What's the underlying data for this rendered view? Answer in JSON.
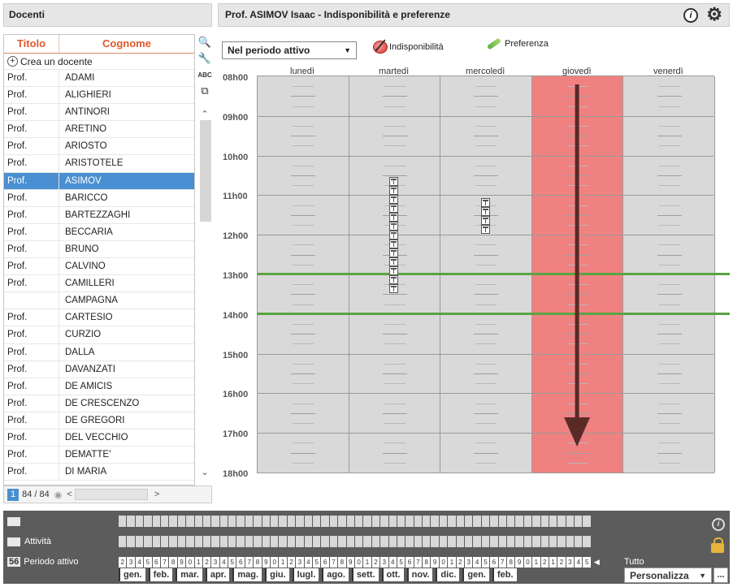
{
  "left": {
    "title": "Docenti",
    "col_title": "Titolo",
    "col_surname": "Cognome",
    "create_label": "Crea un docente",
    "tools": {
      "abc": "ABC"
    },
    "rows": [
      {
        "title": "Prof.",
        "surname": "ADAMI"
      },
      {
        "title": "Prof.",
        "surname": "ALIGHIERI"
      },
      {
        "title": "Prof.",
        "surname": "ANTINORI"
      },
      {
        "title": "Prof.",
        "surname": "ARETINO"
      },
      {
        "title": "Prof.",
        "surname": "ARIOSTO"
      },
      {
        "title": "Prof.",
        "surname": "ARISTOTELE"
      },
      {
        "title": "Prof.",
        "surname": "ASIMOV"
      },
      {
        "title": "Prof.",
        "surname": "BARICCO"
      },
      {
        "title": "Prof.",
        "surname": "BARTEZZAGHI"
      },
      {
        "title": "Prof.",
        "surname": "BECCARIA"
      },
      {
        "title": "Prof.",
        "surname": "BRUNO"
      },
      {
        "title": "Prof.",
        "surname": "CALVINO"
      },
      {
        "title": "Prof.",
        "surname": "CAMILLERI"
      },
      {
        "title": "",
        "surname": "CAMPAGNA"
      },
      {
        "title": "Prof.",
        "surname": "CARTESIO"
      },
      {
        "title": "Prof.",
        "surname": "CURZIO"
      },
      {
        "title": "Prof.",
        "surname": "DALLA"
      },
      {
        "title": "Prof.",
        "surname": "DAVANZATI"
      },
      {
        "title": "Prof.",
        "surname": "DE AMICIS"
      },
      {
        "title": "Prof.",
        "surname": "DE CRESCENZO"
      },
      {
        "title": "Prof.",
        "surname": "DE GREGORI"
      },
      {
        "title": "Prof.",
        "surname": "DEL VECCHIO"
      },
      {
        "title": "Prof.",
        "surname": "DEMATTE'"
      },
      {
        "title": "Prof.",
        "surname": "DI MARIA"
      }
    ],
    "selected_index": 6,
    "footer": {
      "selected_count": "1",
      "count": "84 / 84"
    }
  },
  "right": {
    "title": "Prof. ASIMOV Isaac - Indisponibilità e preferenze",
    "period_select": "Nel periodo attivo",
    "btn_unavailability": "Indisponibilità",
    "btn_preference": "Preferenza",
    "days": [
      "lunedì",
      "martedì",
      "mercoledì",
      "giovedì",
      "venerdì"
    ],
    "hours": [
      "08h00",
      "09h00",
      "10h00",
      "11h00",
      "12h00",
      "13h00",
      "14h00",
      "15h00",
      "16h00",
      "17h00",
      "18h00"
    ],
    "unavailable_day_index": 3,
    "green_lines_hours": [
      "13h00",
      "14h00"
    ],
    "colors": {
      "unavailable": "#f08181",
      "grid": "#d9d9d9",
      "accent": "#4a8fd1",
      "green_line": "#5aa343",
      "arrow": "#5a2a27"
    }
  },
  "bottom": {
    "row1_label": "",
    "row2_label": "Attività",
    "row3_badge": "56",
    "row3_label": "Periodo attivo",
    "weeks": [
      "2",
      "3",
      "4",
      "5",
      "6",
      "7",
      "8",
      "9",
      "0",
      "1",
      "2",
      "3",
      "4",
      "5",
      "6",
      "7",
      "8",
      "9",
      "0",
      "1",
      "2",
      "3",
      "4",
      "5",
      "6",
      "7",
      "8",
      "9",
      "0",
      "1",
      "2",
      "3",
      "4",
      "5",
      "6",
      "7",
      "8",
      "9",
      "0",
      "1",
      "2",
      "3",
      "4",
      "5",
      "6",
      "7",
      "8",
      "9",
      "0",
      "1",
      "2",
      "1",
      "2",
      "3",
      "4",
      "5"
    ],
    "tutto": "Tutto",
    "months": [
      "gen.",
      "feb.",
      "mar.",
      "apr.",
      "mag.",
      "giu.",
      "lugl.",
      "ago.",
      "sett.",
      "ott.",
      "nov.",
      "dic.",
      "gen.",
      "feb."
    ],
    "customize": "Personalizza",
    "more": "..."
  }
}
